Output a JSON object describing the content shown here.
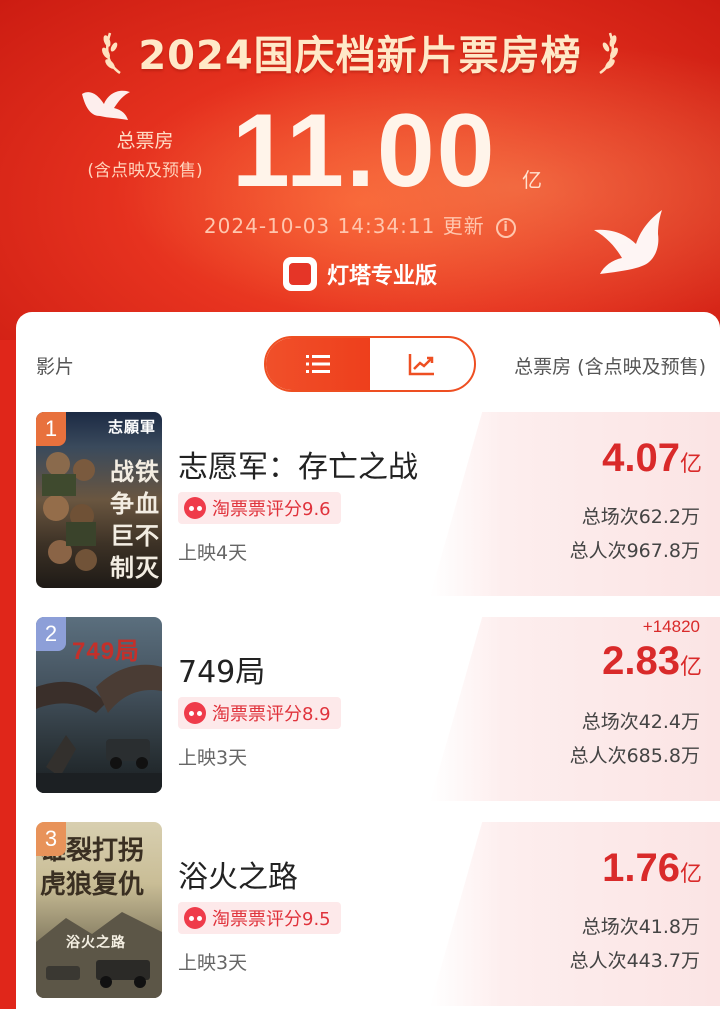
{
  "header": {
    "title": "2024国庆档新片票房榜",
    "total_label": "总票房",
    "total_sub": "(含点映及预售)",
    "total_value": "11.00",
    "total_unit": "亿",
    "updated": "2024-10-03 14:34:11 更新",
    "brand": "灯塔专业版"
  },
  "list": {
    "col_left": "影片",
    "col_right": "总票房 (含点映及预售)",
    "view_toggle": [
      "list-icon",
      "trend-chart-icon"
    ],
    "movies": [
      {
        "rank": "1",
        "title": "志愿军：存亡之战",
        "poster_text": [
          "志願軍",
          "战铁",
          "争血",
          "巨不",
          "制灭"
        ],
        "rating": "淘票票评分9.6",
        "days": "上映4天",
        "box_office": "4.07",
        "unit": "亿",
        "delta": "",
        "shows": "总场次62.2万",
        "admissions": "总人次967.8万"
      },
      {
        "rank": "2",
        "title": "749局",
        "poster_text": [
          "749局"
        ],
        "rating": "淘票票评分8.9",
        "days": "上映3天",
        "box_office": "2.83",
        "unit": "亿",
        "delta": "+14820",
        "shows": "总场次42.4万",
        "admissions": "总人次685.8万"
      },
      {
        "rank": "3",
        "title": "浴火之路",
        "poster_text": [
          "雄裂打拐",
          "虎狼复仇",
          "浴火之路"
        ],
        "rating": "淘票票评分9.5",
        "days": "上映3天",
        "box_office": "1.76",
        "unit": "亿",
        "delta": "",
        "shows": "总场次41.8万",
        "admissions": "总人次443.7万"
      }
    ]
  },
  "colors": {
    "header_red": "#e6321f",
    "accent_orange": "#ee4f22",
    "value_red": "#d92a2a",
    "rating_pink": "#fde9ea",
    "rank1": "#e8713d",
    "rank2": "#8d9fd8",
    "rank3": "#e8935a"
  }
}
